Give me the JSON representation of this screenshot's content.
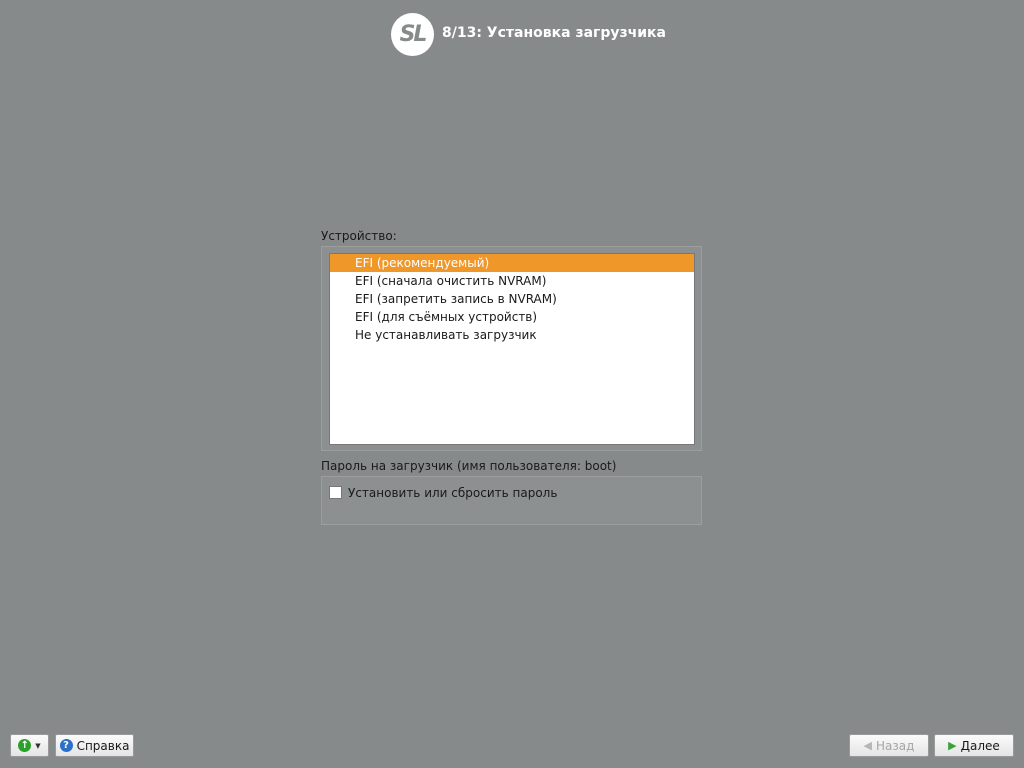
{
  "header": {
    "logo_text": "SL",
    "step_title": "8/13: Установка загрузчика"
  },
  "device": {
    "label": "Устройство:",
    "options": [
      "EFI (рекомендуемый)",
      "EFI (сначала очистить NVRAM)",
      "EFI (запретить запись в NVRAM)",
      "EFI (для съёмных устройств)",
      "Не устанавливать загрузчик"
    ],
    "selected_index": 0
  },
  "password": {
    "label": "Пароль на загрузчик (имя пользователя: boot)",
    "checkbox_label": "Установить или сбросить пароль",
    "checked": false
  },
  "footer": {
    "help_label": "Справка",
    "back_label": "Назад",
    "next_label": "Далее"
  },
  "colors": {
    "background": "#878a8b",
    "selection": "#f0972a"
  },
  "icons": {
    "up": "up-arrow-icon",
    "help": "help-icon",
    "back": "back-arrow-icon",
    "next": "next-arrow-icon"
  }
}
